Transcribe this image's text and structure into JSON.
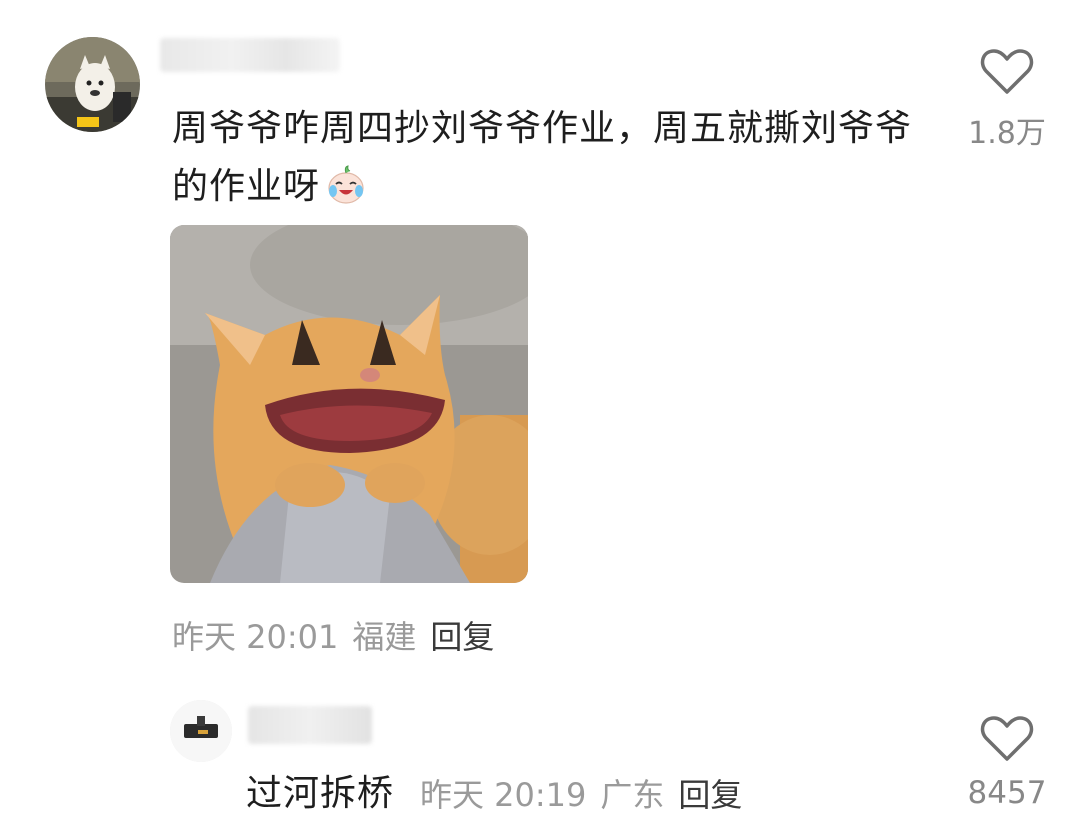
{
  "comment": {
    "text": "周爷爷咋周四抄刘爷爷作业，周五就撕刘爷爷的作业呀",
    "emoji": "crying-laughing-emoji",
    "time": "昨天 20:01",
    "location": "福建",
    "reply_label": "回复",
    "likes": "1.8万"
  },
  "reply": {
    "text": "过河拆桥",
    "time": "昨天 20:19",
    "location": "广东",
    "reply_label": "回复",
    "likes": "8457"
  },
  "icons": {
    "like": "heart-outline-icon"
  },
  "colors": {
    "meta": "#9a9a9a",
    "text": "#1e1e1e",
    "like_count": "#888888"
  }
}
